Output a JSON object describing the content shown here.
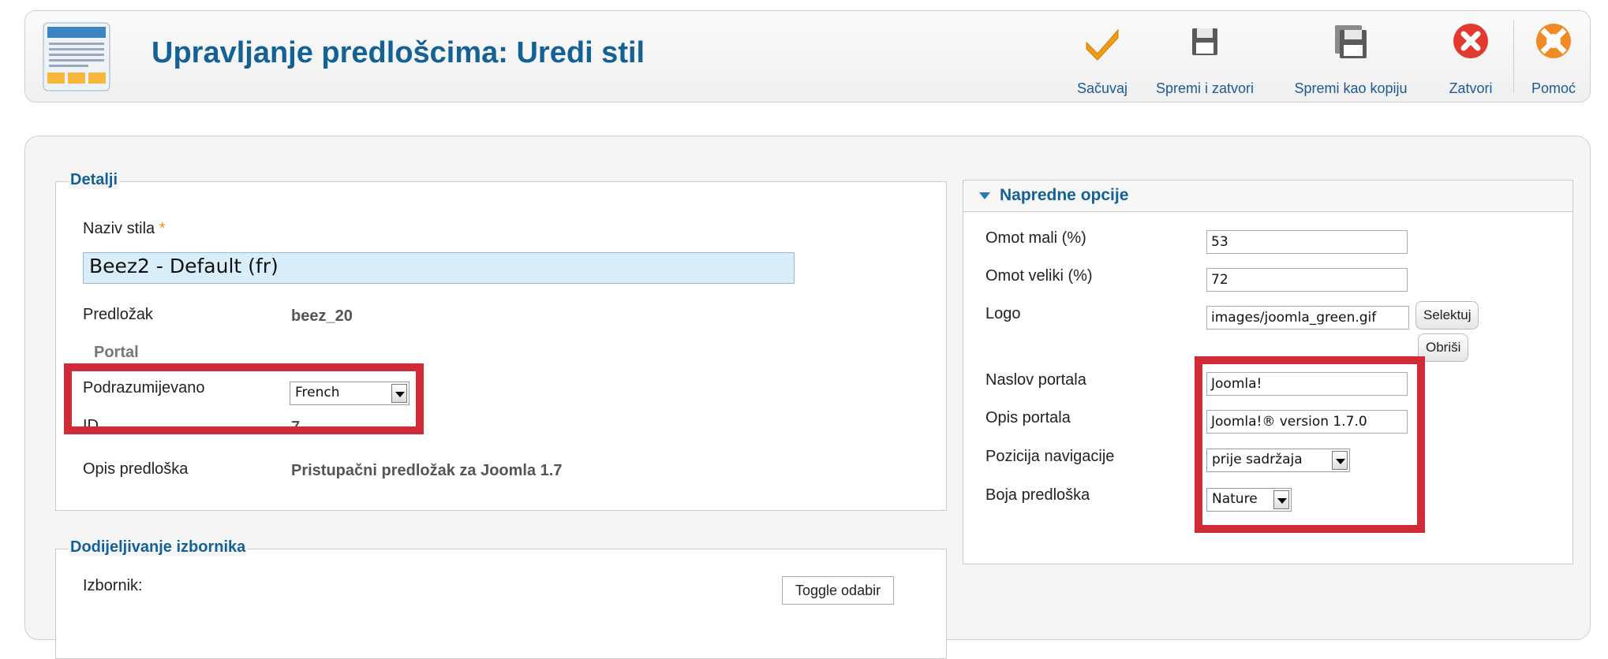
{
  "header": {
    "title": "Upravljanje predlošcima: Uredi stil",
    "buttons": {
      "save": "Sačuvaj",
      "save_close": "Spremi i zatvori",
      "save_copy": "Spremi kao kopiju",
      "close": "Zatvori",
      "help": "Pomoć"
    }
  },
  "details": {
    "legend": "Detalji",
    "style_name_label": "Naziv stila",
    "required_mark": "*",
    "style_name_value": "Beez2 - Default (fr)",
    "template_label": "Predložak",
    "template_value": "beez_20",
    "client_label": "Portal",
    "default_label": "Podrazumijevano",
    "default_value": "French",
    "id_label": "ID",
    "id_value": "7",
    "description_label": "Opis predloška",
    "description_value": "Pristupačni predložak za Joomla 1.7"
  },
  "menu_assignment": {
    "legend": "Dodijeljivanje izbornika",
    "menu_label": "Izbornik:",
    "toggle_button": "Toggle odabir"
  },
  "advanced": {
    "title": "Napredne opcije",
    "fields": {
      "wrapper_small_label": "Omot mali (%)",
      "wrapper_small_value": "53",
      "wrapper_large_label": "Omot veliki (%)",
      "wrapper_large_value": "72",
      "logo_label": "Logo",
      "logo_value": "images/joomla_green.gif",
      "logo_select": "Selektuj",
      "logo_clear": "Obriši",
      "site_title_label": "Naslov portala",
      "site_title_value": "Joomla!",
      "site_description_label": "Opis portala",
      "site_description_value": "Joomla!® version 1.7.0",
      "nav_position_label": "Pozicija navigacije",
      "nav_position_value": "prije sadržaja",
      "template_color_label": "Boja predloška",
      "template_color_value": "Nature"
    }
  },
  "colors": {
    "title_blue": "#146295",
    "highlight_red": "#d12b37",
    "save_orange": "#f39c12",
    "close_red": "#e23b2e"
  }
}
